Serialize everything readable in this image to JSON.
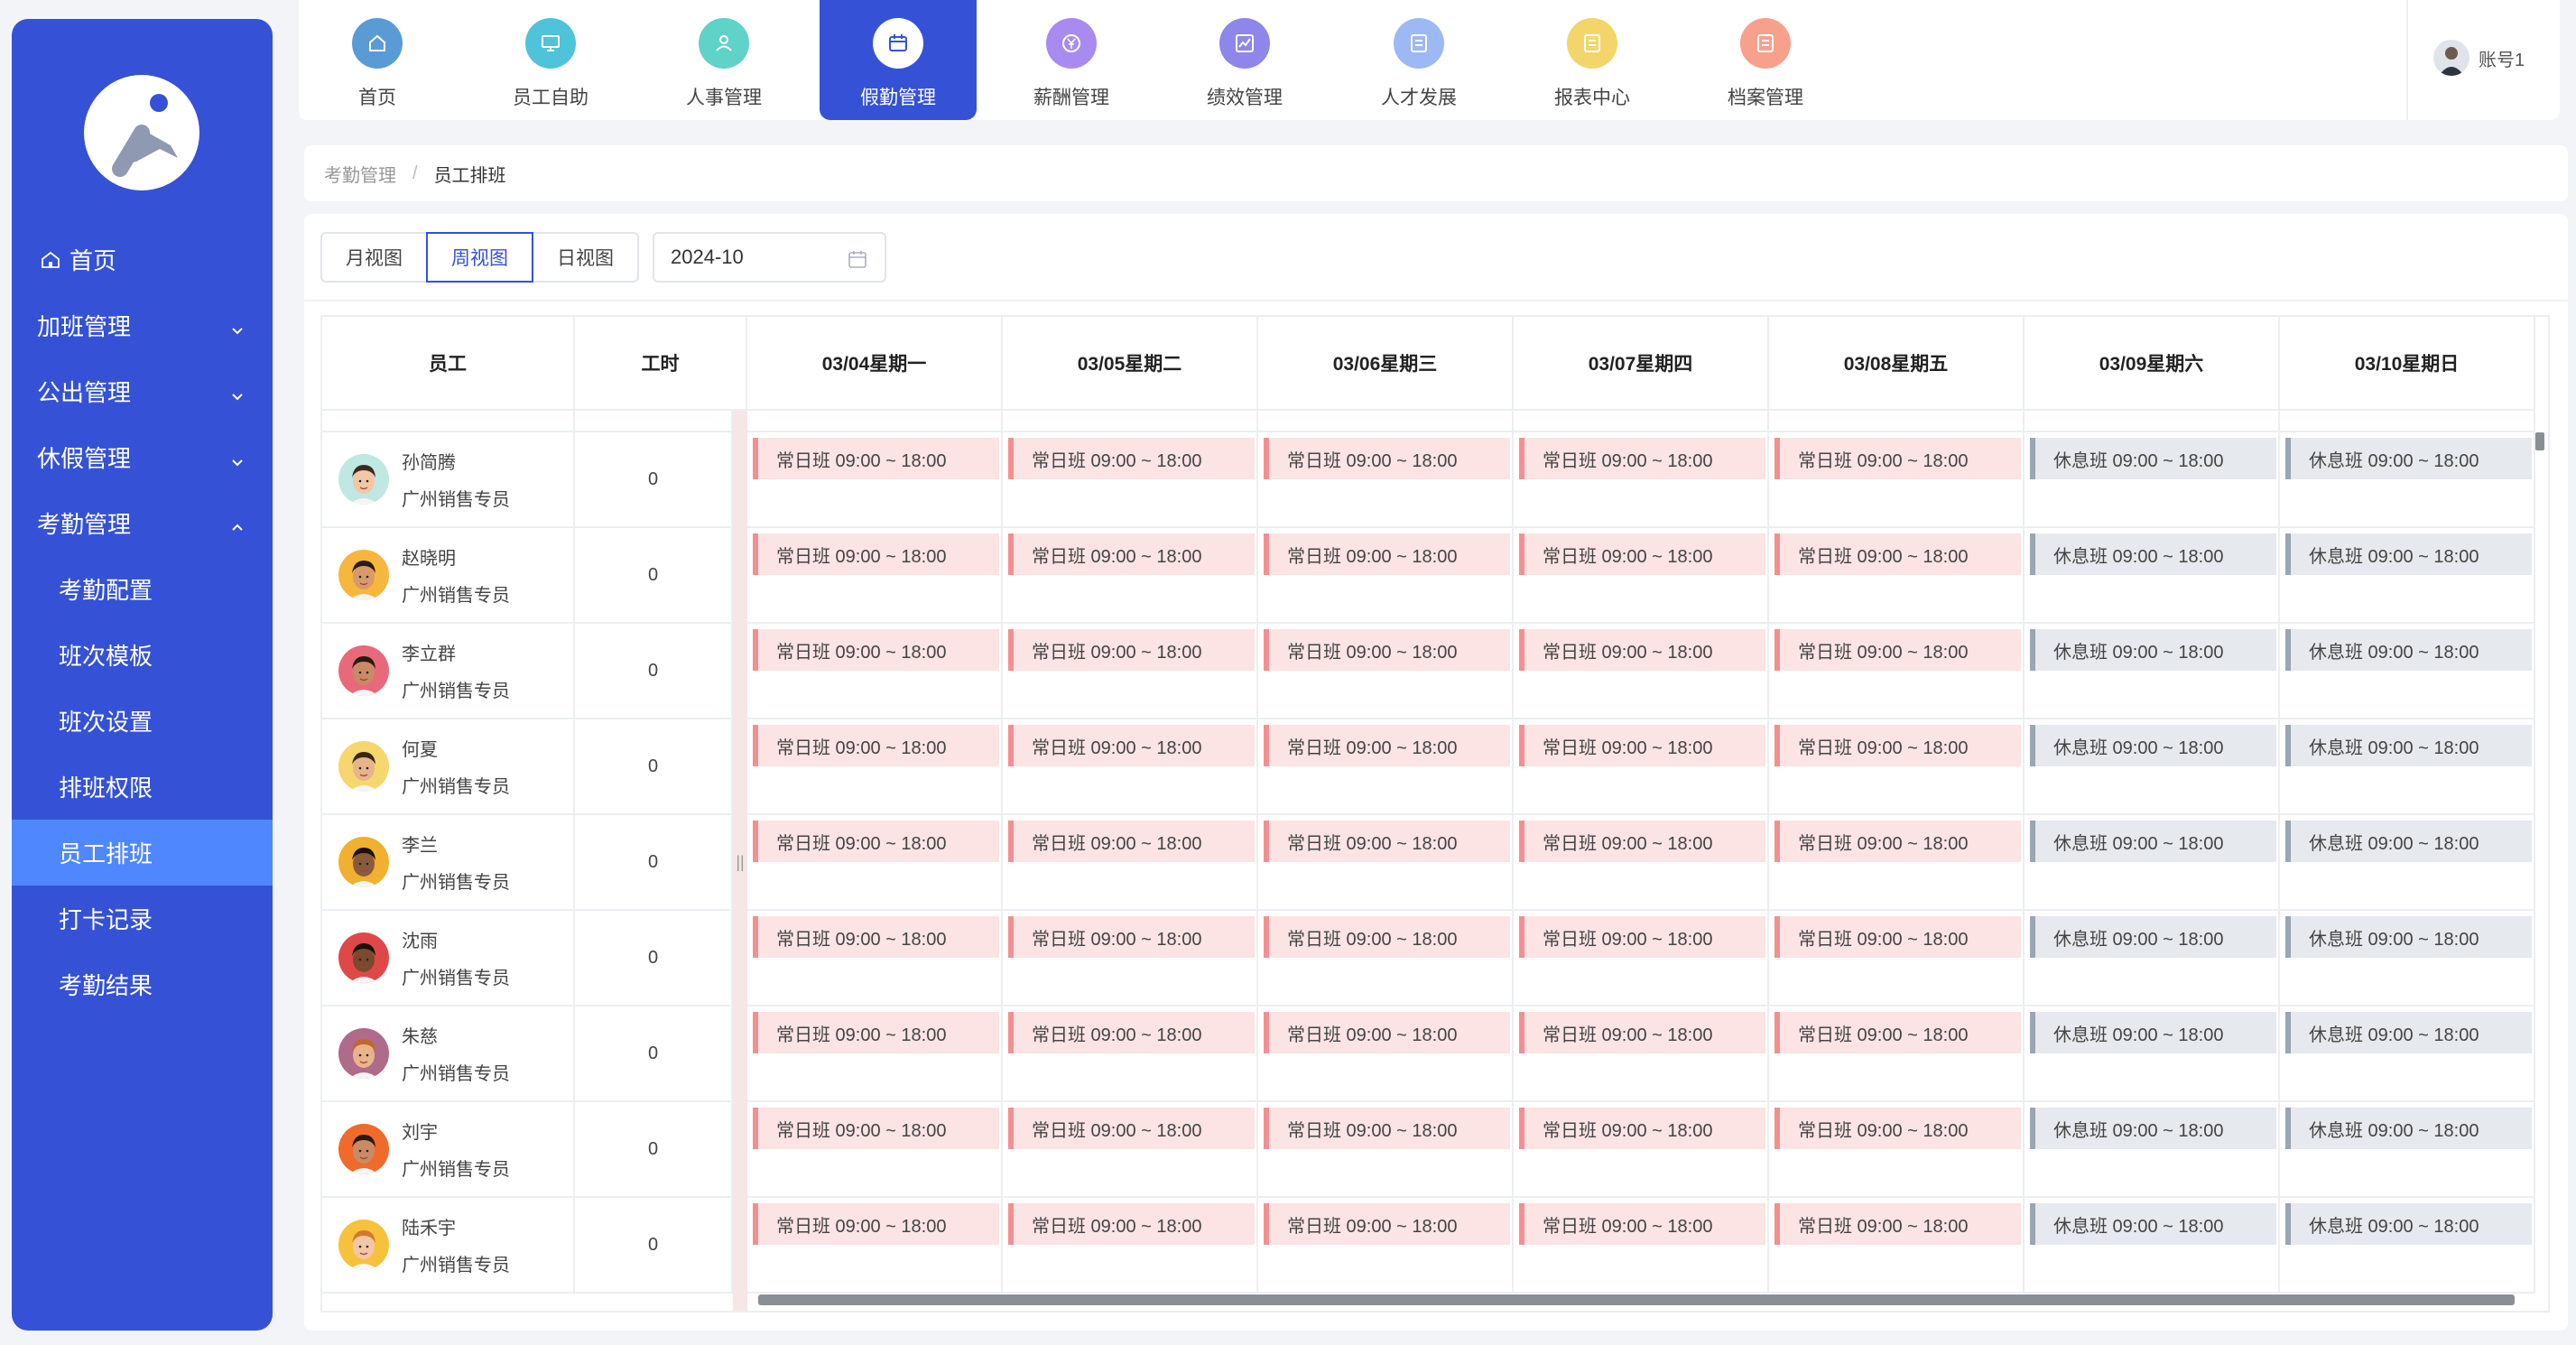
{
  "sidebar": {
    "items": [
      {
        "label": "首页",
        "type": "home"
      },
      {
        "label": "加班管理",
        "type": "group"
      },
      {
        "label": "公出管理",
        "type": "group"
      },
      {
        "label": "休假管理",
        "type": "group"
      },
      {
        "label": "考勤管理",
        "type": "group-open"
      },
      {
        "label": "考勤配置",
        "type": "sub"
      },
      {
        "label": "班次模板",
        "type": "sub"
      },
      {
        "label": "班次设置",
        "type": "sub"
      },
      {
        "label": "排班权限",
        "type": "sub"
      },
      {
        "label": "员工排班",
        "type": "sub-active"
      },
      {
        "label": "打卡记录",
        "type": "sub"
      },
      {
        "label": "考勤结果",
        "type": "sub"
      }
    ]
  },
  "topnav": {
    "items": [
      {
        "label": "首页",
        "color": "#5b9bd5",
        "icon": "home-icon"
      },
      {
        "label": "员工自助",
        "color": "#4fc3d9",
        "icon": "monitor-icon"
      },
      {
        "label": "人事管理",
        "color": "#5fd3c7",
        "icon": "user-icon"
      },
      {
        "label": "假勤管理",
        "color": "#3552d6",
        "icon": "calendar-icon"
      },
      {
        "label": "薪酬管理",
        "color": "#a78bf0",
        "icon": "yen-icon"
      },
      {
        "label": "绩效管理",
        "color": "#8e86e8",
        "icon": "chart-icon"
      },
      {
        "label": "人才发展",
        "color": "#9cb8f5",
        "icon": "doc-icon"
      },
      {
        "label": "报表中心",
        "color": "#f3d56a",
        "icon": "doc-icon"
      },
      {
        "label": "档案管理",
        "color": "#f7a08c",
        "icon": "doc-icon"
      }
    ],
    "account": "账号1"
  },
  "breadcrumb": {
    "parent": "考勤管理",
    "sep": "/",
    "current": "员工排班"
  },
  "toolbar": {
    "views": [
      "月视图",
      "周视图",
      "日视图"
    ],
    "active_view": "周视图",
    "date": "2024-10"
  },
  "table": {
    "headers": {
      "employee": "员工",
      "hours": "工时"
    },
    "days": [
      "03/04星期一",
      "03/05星期二",
      "03/06星期三",
      "03/07星期四",
      "03/08星期五",
      "03/09星期六",
      "03/10星期日"
    ],
    "partial_role": "广州销售专员",
    "employees": [
      {
        "name": "孙简腾",
        "role": "广州销售专员",
        "hours": "0",
        "skin": "#f1c7a5",
        "hair": "#3b2a20",
        "bg": "#bfe8e2"
      },
      {
        "name": "赵晓明",
        "role": "广州销售专员",
        "hours": "0",
        "skin": "#d79a6b",
        "hair": "#2a1a12",
        "bg": "#f6b73c"
      },
      {
        "name": "李立群",
        "role": "广州销售专员",
        "hours": "0",
        "skin": "#c98a66",
        "hair": "#2a1a12",
        "bg": "#e86a7a"
      },
      {
        "name": "何夏",
        "role": "广州销售专员",
        "hours": "0",
        "skin": "#e8b48c",
        "hair": "#3a2518",
        "bg": "#f5d76e"
      },
      {
        "name": "李兰",
        "role": "广州销售专员",
        "hours": "0",
        "skin": "#8a5a3c",
        "hair": "#1a110b",
        "bg": "#f0b030"
      },
      {
        "name": "沈雨",
        "role": "广州销售专员",
        "hours": "0",
        "skin": "#7a4a2e",
        "hair": "#1a110b",
        "bg": "#e04848"
      },
      {
        "name": "朱慈",
        "role": "广州销售专员",
        "hours": "0",
        "skin": "#e8b48c",
        "hair": "#c4652e",
        "bg": "#b06a8a"
      },
      {
        "name": "刘宇",
        "role": "广州销售专员",
        "hours": "0",
        "skin": "#c98a66",
        "hair": "#2a1a12",
        "bg": "#f06a2a"
      },
      {
        "name": "陆禾宇",
        "role": "广州销售专员",
        "hours": "0",
        "skin": "#f1c7a5",
        "hair": "#d4782e",
        "bg": "#f6c23c"
      }
    ],
    "work_shift": "常日班 09:00 ~ 18:00",
    "rest_shift": "休息班 09:00 ~ 18:00",
    "week_pattern": [
      "work",
      "work",
      "work",
      "work",
      "work",
      "rest",
      "rest"
    ]
  }
}
